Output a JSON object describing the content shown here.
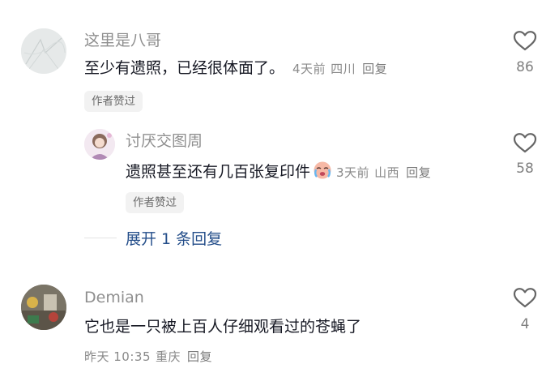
{
  "comments": [
    {
      "author": "这里是八哥",
      "text": "至少有遗照，已经很体面了。",
      "time": "4天前",
      "location": "四川",
      "reply_label": "回复",
      "badge": "作者赞过",
      "likes": "86"
    },
    {
      "author": "讨厌交图周",
      "text": "遗照甚至还有几百张复印件",
      "emoji": "crying-face-emoji",
      "time": "3天前",
      "location": "山西",
      "reply_label": "回复",
      "badge": "作者赞过",
      "likes": "58"
    },
    {
      "author": "Demian",
      "text": "它也是一只被上百人仔细观看过的苍蝇了",
      "time": "昨天 10:35",
      "location": "重庆",
      "reply_label": "回复",
      "likes": "4"
    }
  ],
  "expand_replies": "展开 1 条回复",
  "icons": {
    "like": "heart-outline-icon"
  },
  "colors": {
    "link": "#244e8a",
    "meta": "#8a8a8a",
    "text": "#161823"
  }
}
